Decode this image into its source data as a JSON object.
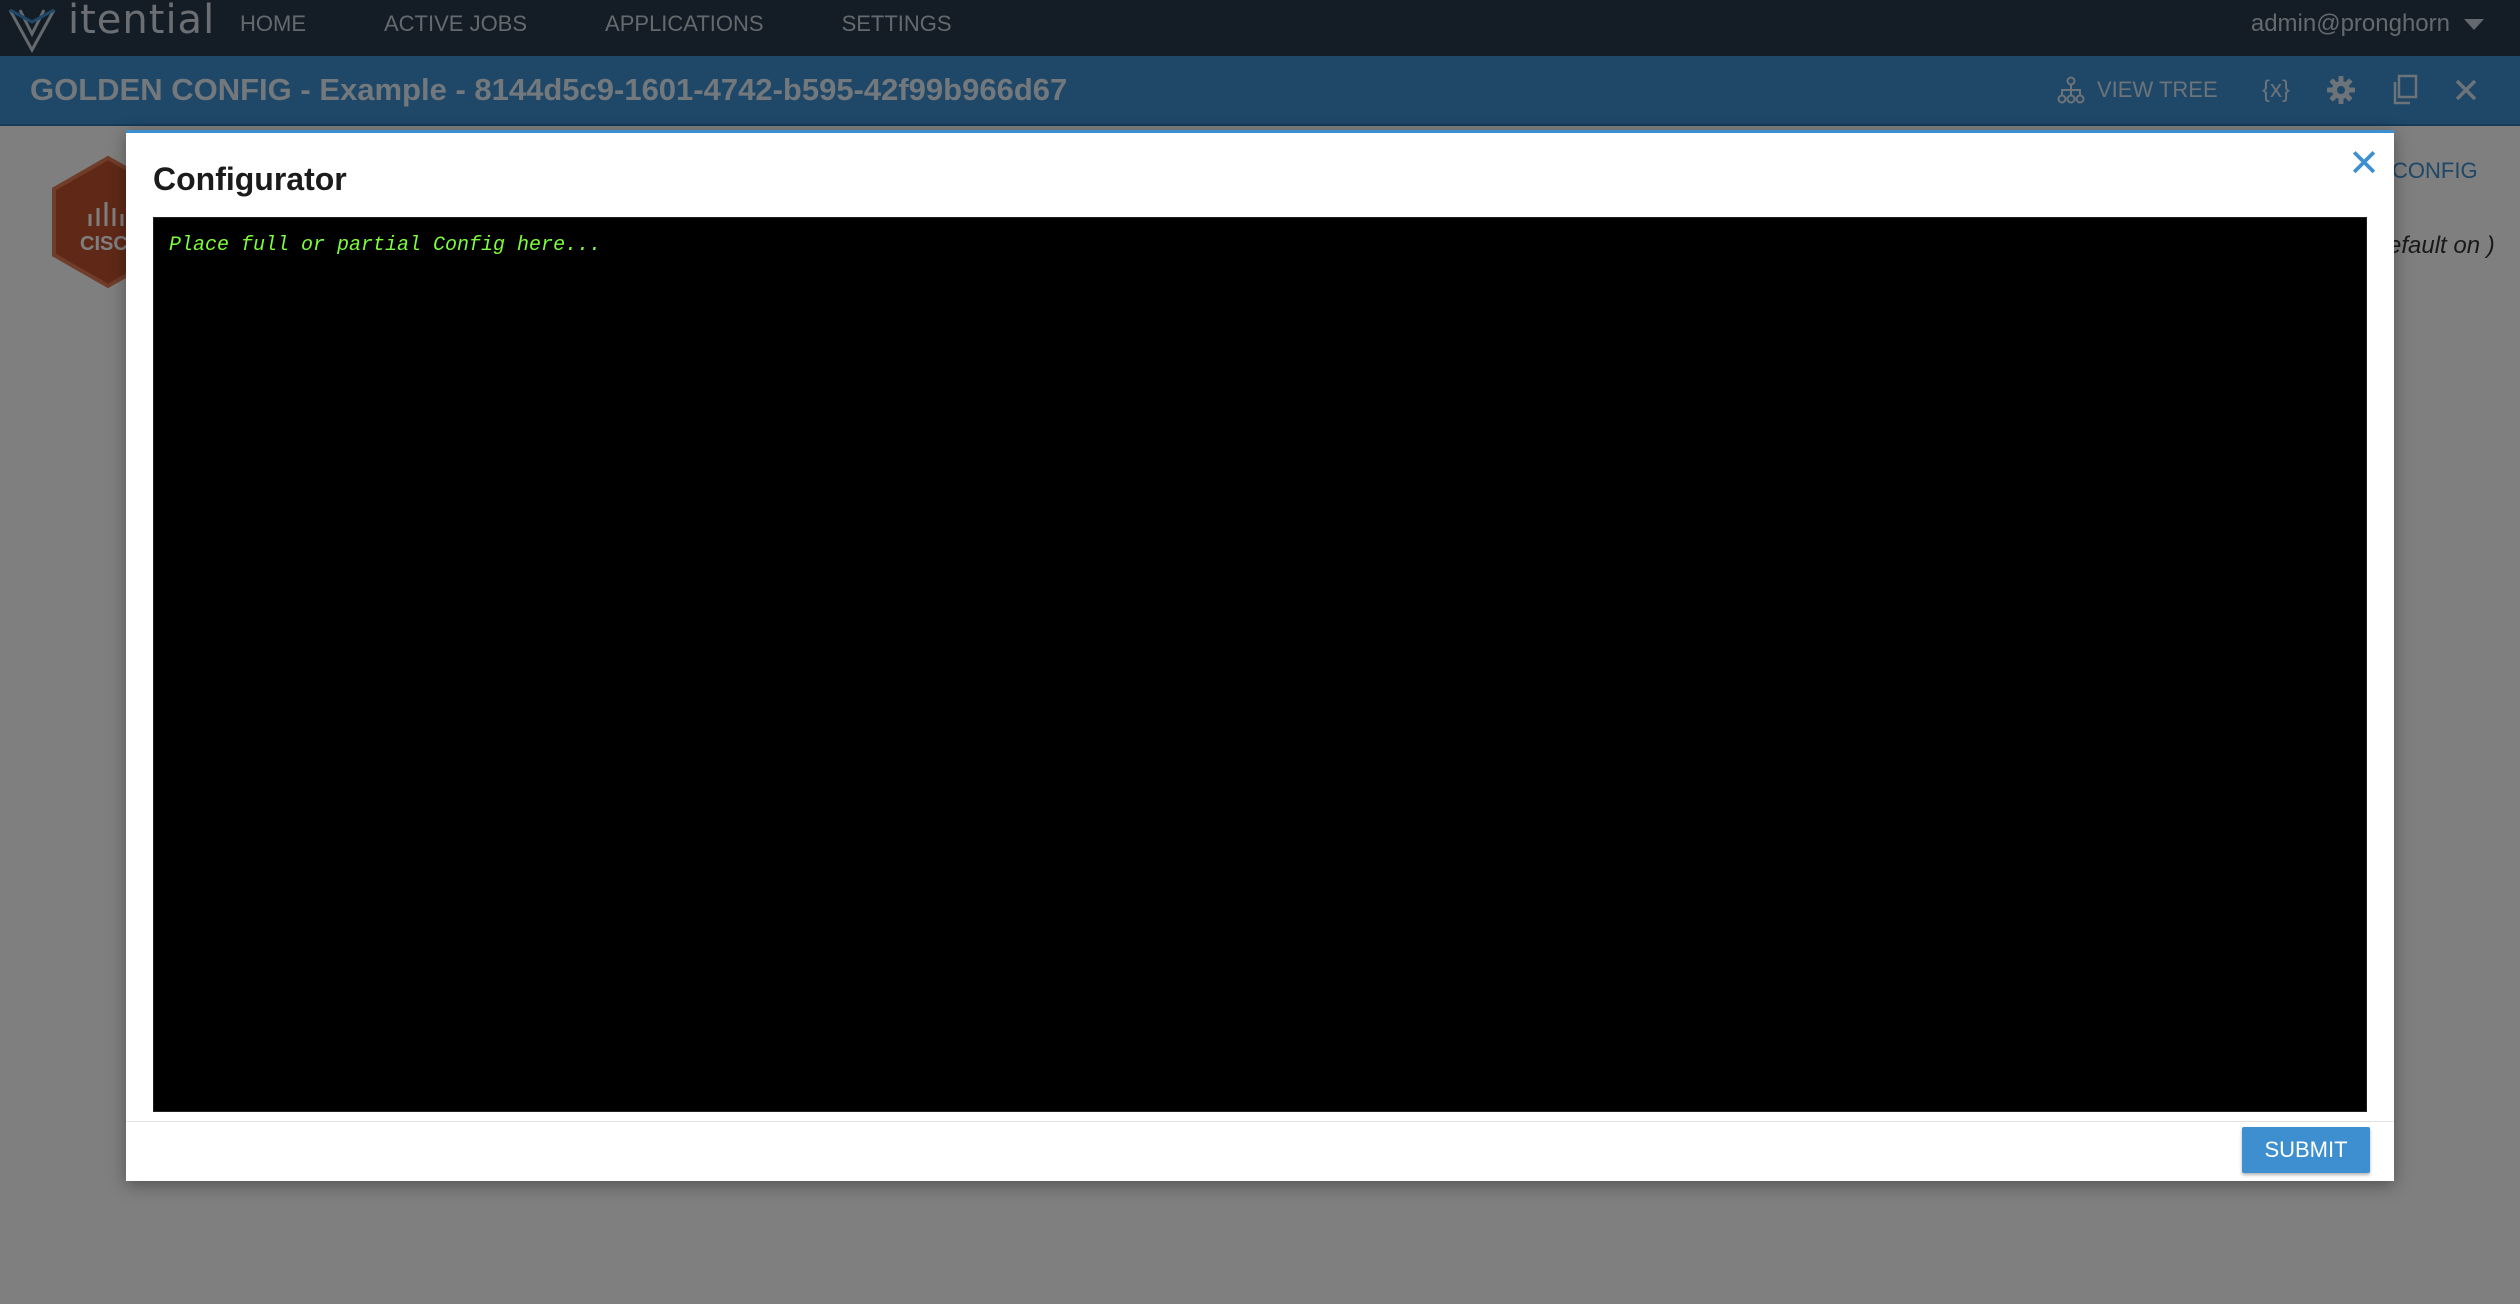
{
  "app": {
    "logo_text": "itential"
  },
  "nav": {
    "items": [
      {
        "label": "HOME"
      },
      {
        "label": "ACTIVE JOBS"
      },
      {
        "label": "APPLICATIONS"
      },
      {
        "label": "SETTINGS"
      }
    ],
    "user": "admin@pronghorn"
  },
  "header": {
    "title": "GOLDEN CONFIG - Example - 8144d5c9-1601-4742-b595-42f99b966d67",
    "view_tree_label": "VIEW TREE",
    "variables_label": "{x}",
    "icons": [
      "hierarchy-icon",
      "gear-icon",
      "copy-icon",
      "close-icon"
    ]
  },
  "background": {
    "config_link": "CONFIG",
    "default_text": "efault on )",
    "badge_text": "CISC",
    "badge_color": "#c0522e"
  },
  "modal": {
    "title": "Configurator",
    "close_glyph": "✕",
    "editor_placeholder": "Place full or partial Config here...",
    "submit_label": "SUBMIT"
  },
  "colors": {
    "nav_bg": "#283a4a",
    "header_bg": "#3e8fd0",
    "accent": "#3e8fd0",
    "editor_bg": "#000000",
    "editor_text": "#7cfc3a"
  }
}
